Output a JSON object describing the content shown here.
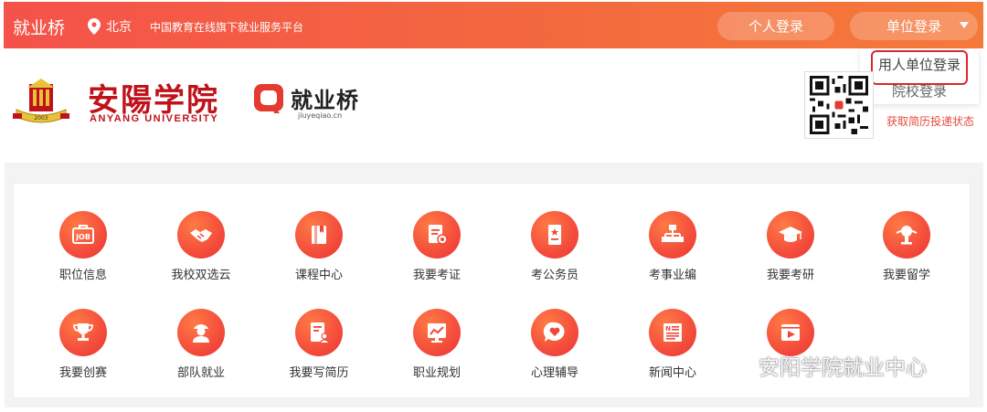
{
  "topbar": {
    "brand": "就业桥",
    "location": "北京",
    "slogan": "中国教育在线旗下就业服务平台",
    "personal_login": "个人登录",
    "unit_login": "单位登录"
  },
  "dropdown": {
    "items": [
      "用人单位登录",
      "院校登录"
    ]
  },
  "header": {
    "school_cn": "安陽学院",
    "school_en": "ANYANG UNIVERSITY",
    "emblem_year": "2003",
    "jyq_name": "就业桥",
    "jyq_url": "jiuyeqiao.cn",
    "qr_caption": "获取简历投递状态"
  },
  "services": [
    {
      "label": "职位信息",
      "icon": "job-icon"
    },
    {
      "label": "我校双选云",
      "icon": "handshake-icon"
    },
    {
      "label": "课程中心",
      "icon": "book-icon"
    },
    {
      "label": "我要考证",
      "icon": "certificate-icon"
    },
    {
      "label": "考公务员",
      "icon": "civil-servant-icon"
    },
    {
      "label": "考事业编",
      "icon": "org-chart-icon"
    },
    {
      "label": "我要考研",
      "icon": "graduation-cap-icon"
    },
    {
      "label": "我要留学",
      "icon": "study-abroad-icon"
    },
    {
      "label": "我要创赛",
      "icon": "trophy-icon"
    },
    {
      "label": "部队就业",
      "icon": "soldier-icon"
    },
    {
      "label": "我要写简历",
      "icon": "resume-icon"
    },
    {
      "label": "职业规划",
      "icon": "career-chart-icon"
    },
    {
      "label": "心理辅导",
      "icon": "heart-chat-icon"
    },
    {
      "label": "新闻中心",
      "icon": "news-icon"
    },
    {
      "label": "",
      "icon": "video-icon"
    }
  ],
  "watermark": {
    "text": "安阳学院就业中心"
  },
  "colors": {
    "accent": "#f4524a",
    "school_red": "#c0121a",
    "highlight": "#d8282e"
  }
}
